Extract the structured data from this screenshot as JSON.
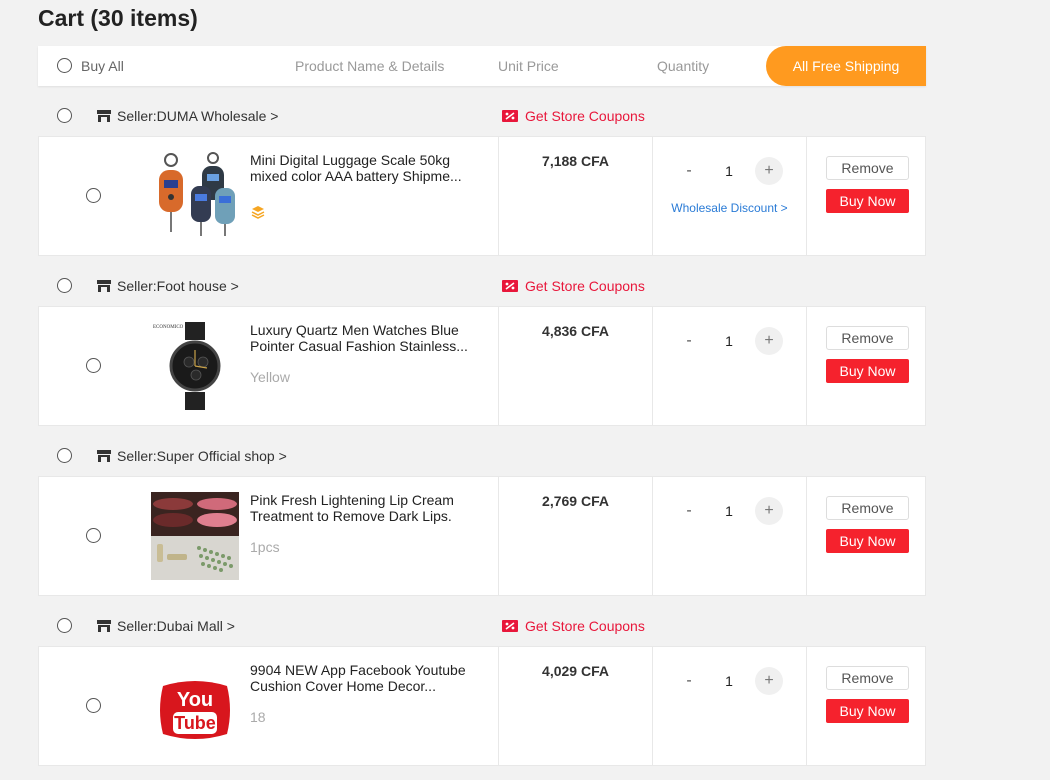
{
  "cart": {
    "title": "Cart (30 items)"
  },
  "header": {
    "buy_all": "Buy All",
    "col_product": "Product Name & Details",
    "col_price": "Unit Price",
    "col_quantity": "Quantity",
    "free_shipping": "All Free Shipping"
  },
  "actions": {
    "remove": "Remove",
    "buy_now": "Buy Now",
    "minus": "-",
    "plus": "+"
  },
  "icons": {
    "store": "store-icon",
    "coupon": "coupon-icon",
    "layers": "layers-icon"
  },
  "colors": {
    "accent_orange": "#ff9a1f",
    "coupon_red": "#e8173b",
    "buy_red": "#f5222d",
    "link_blue": "#2a7bd6"
  },
  "groups": [
    {
      "seller": "Seller:DUMA Wholesale >",
      "coupon": "Get Store Coupons",
      "item": {
        "name_line1": "Mini Digital Luggage Scale 50kg",
        "name_line2": "mixed color AAA battery Shipme...",
        "variant": "",
        "price": "7,188 CFA",
        "quantity": "1",
        "wholesale": "Wholesale Discount >"
      }
    },
    {
      "seller": "Seller:Foot house >",
      "coupon": "Get Store Coupons",
      "item": {
        "name_line1": "Luxury Quartz Men Watches Blue",
        "name_line2": "Pointer Casual Fashion Stainless...",
        "variant": "Yellow",
        "price": "4,836 CFA",
        "quantity": "1",
        "thumb_text": "ECONOMICO"
      }
    },
    {
      "seller": "Seller:Super Official shop >",
      "item": {
        "name_line1": "Pink Fresh Lightening Lip Cream",
        "name_line2": "Treatment to Remove Dark Lips.",
        "variant": "1pcs",
        "price": "2,769 CFA",
        "quantity": "1"
      }
    },
    {
      "seller": "Seller:Dubai Mall >",
      "coupon": "Get Store Coupons",
      "item": {
        "name_line1": "9904 NEW App Facebook Youtube",
        "name_line2": "Cushion Cover Home Decor...",
        "variant": "18",
        "price": "4,029 CFA",
        "quantity": "1",
        "thumb_text_1": "You",
        "thumb_text_2": "Tube"
      }
    }
  ]
}
